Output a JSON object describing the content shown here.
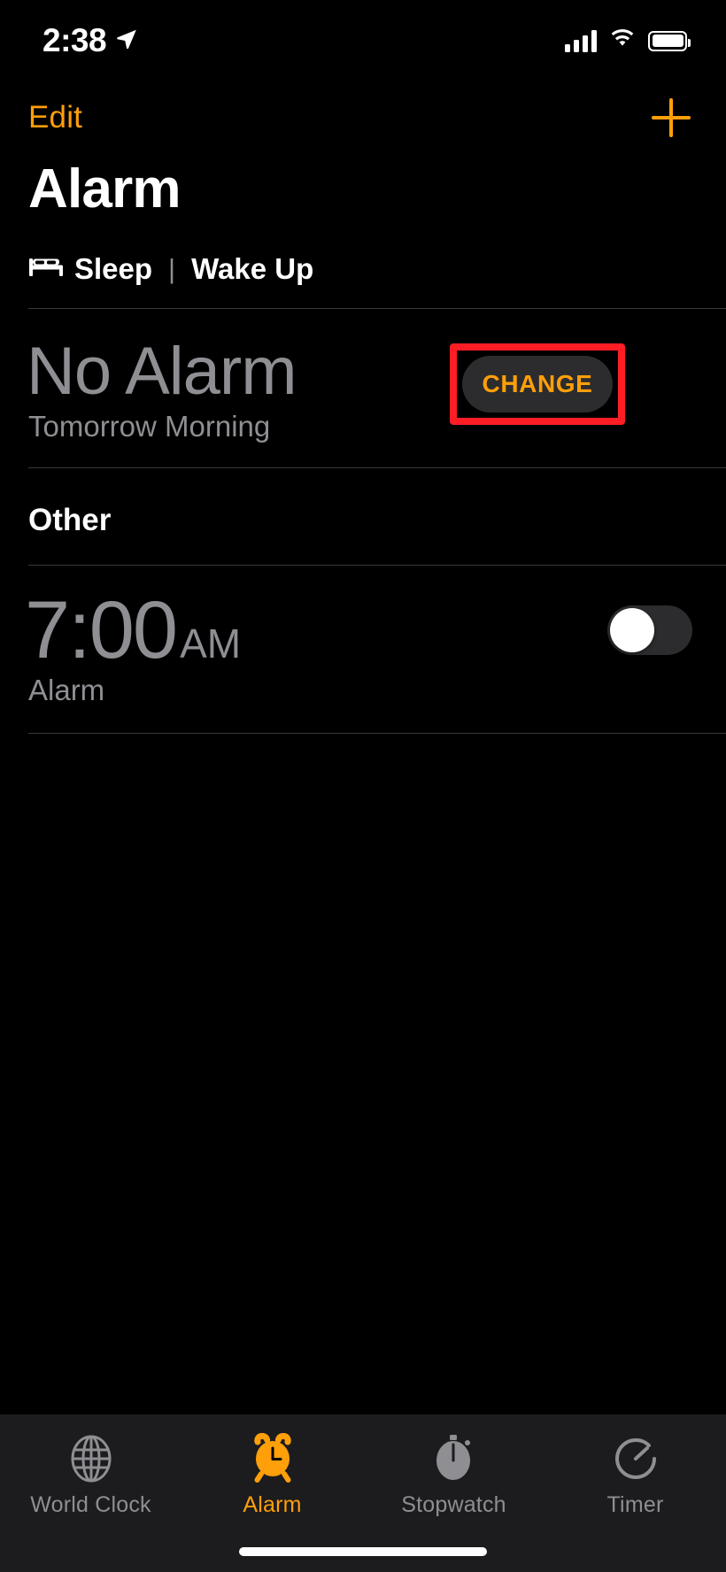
{
  "status_bar": {
    "time": "2:38",
    "location_icon": "location-arrow-icon",
    "cellular_icon": "cellular-bars-icon",
    "wifi_icon": "wifi-icon",
    "battery_icon": "battery-full-icon"
  },
  "nav_bar": {
    "edit_label": "Edit",
    "add_icon": "plus-icon"
  },
  "header": {
    "title": "Alarm"
  },
  "sleep_section": {
    "bed_icon": "bed-icon",
    "label_sleep": "Sleep",
    "separator": "|",
    "label_wake": "Wake Up",
    "alarm_time": "No Alarm",
    "alarm_subtitle": "Tomorrow Morning",
    "change_button": "CHANGE",
    "highlight_color": "#ff1d25"
  },
  "other_section": {
    "header": "Other",
    "alarms": [
      {
        "time": "7:00",
        "meridiem": "AM",
        "label": "Alarm",
        "enabled": false
      }
    ]
  },
  "tab_bar": {
    "tabs": [
      {
        "label": "World Clock",
        "icon": "globe-icon",
        "active": false
      },
      {
        "label": "Alarm",
        "icon": "alarm-clock-icon",
        "active": true
      },
      {
        "label": "Stopwatch",
        "icon": "stopwatch-icon",
        "active": false
      },
      {
        "label": "Timer",
        "icon": "timer-icon",
        "active": false
      }
    ],
    "active_color": "#ff9f0a",
    "inactive_color": "#8e8e93"
  }
}
